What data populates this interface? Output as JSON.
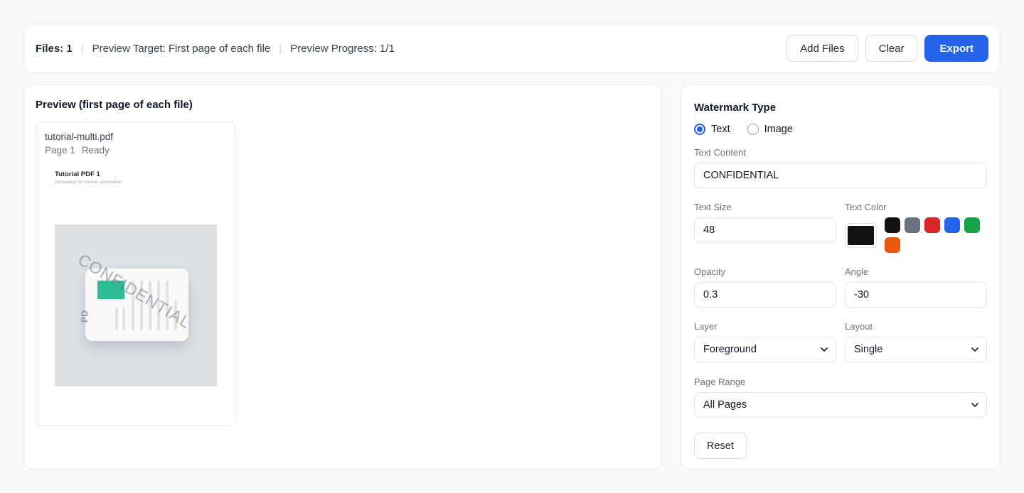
{
  "toolbar": {
    "files_label": "Files: 1",
    "separator": "|",
    "preview_target": "Preview Target: First page of each file",
    "preview_progress": "Preview Progress: 1/1",
    "add_files_label": "Add Files",
    "clear_label": "Clear",
    "export_label": "Export"
  },
  "preview_panel": {
    "title": "Preview (first page of each file)",
    "file": {
      "name": "tutorial-multi.pdf",
      "page_label": "Page 1",
      "status": "Ready",
      "thumbnail": {
        "doc_title": "Tutorial PDF 1",
        "doc_subtitle": "Generated for tutorial automation",
        "watermark_text": "CONFIDENTIAL",
        "placeholder_label": "PD"
      }
    }
  },
  "settings_panel": {
    "title": "Watermark Type",
    "type_text_label": "Text",
    "type_image_label": "Image",
    "text_content": {
      "label": "Text Content",
      "value": "CONFIDENTIAL"
    },
    "text_size": {
      "label": "Text Size",
      "value": "48"
    },
    "text_color": {
      "label": "Text Color",
      "current": "#111111",
      "presets": [
        "#111111",
        "#6b7280",
        "#dc2626",
        "#2563eb",
        "#16a34a",
        "#ea580c"
      ]
    },
    "opacity": {
      "label": "Opacity",
      "value": "0.3"
    },
    "angle": {
      "label": "Angle",
      "value": "-30"
    },
    "layer": {
      "label": "Layer",
      "value": "Foreground"
    },
    "layout": {
      "label": "Layout",
      "value": "Single"
    },
    "page_range": {
      "label": "Page Range",
      "value": "All Pages"
    },
    "reset_label": "Reset"
  },
  "colors": {
    "accent_blue": "#2563eb",
    "thumbnail_teal": "#2dbd96",
    "thumbnail_gray_box": "#dce1e5"
  }
}
